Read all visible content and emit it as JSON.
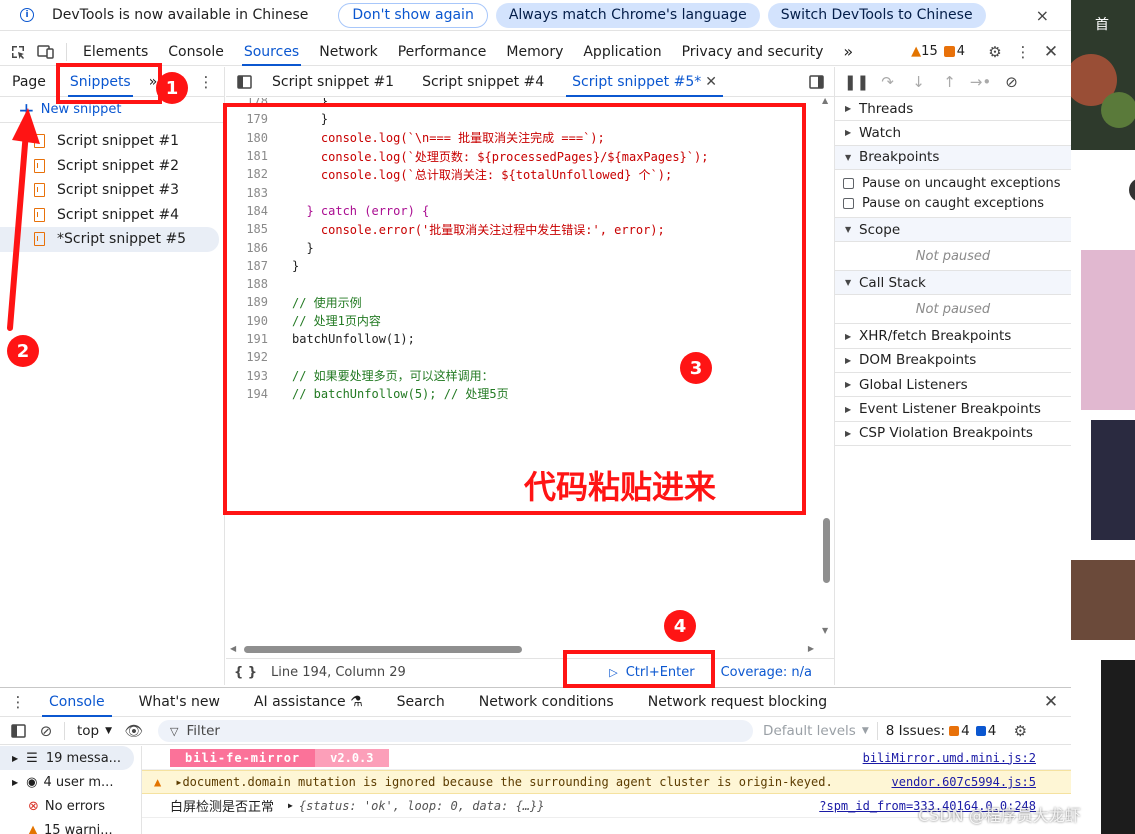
{
  "infobar": {
    "message": "DevTools is now available in Chinese",
    "dont_show": "Don't show again",
    "match_lang": "Always match Chrome's language",
    "switch_lang": "Switch DevTools to Chinese",
    "close": "×"
  },
  "main_tabs": {
    "items": [
      "Elements",
      "Console",
      "Sources",
      "Network",
      "Performance",
      "Memory",
      "Application",
      "Privacy and security"
    ],
    "active": "Sources",
    "more": "»",
    "warnings": "15",
    "errors": "4"
  },
  "navigator": {
    "tabs": [
      "Page",
      "Snippets"
    ],
    "more": "»",
    "new_snippet": "New snippet",
    "snippets": [
      "Script snippet #1",
      "Script snippet #2",
      "Script snippet #3",
      "Script snippet #4",
      "*Script snippet #5"
    ]
  },
  "editor": {
    "tabs": [
      "Script snippet #1",
      "Script snippet #4",
      "Script snippet #5*"
    ],
    "lines": [
      {
        "n": "178",
        "code": "    }"
      },
      {
        "n": "179",
        "code": "    }"
      },
      {
        "n": "180",
        "code": "    console.log(`\\n=== 批量取消关注完成 ===`);"
      },
      {
        "n": "181",
        "code": "    console.log(`处理页数: ${processedPages}/${maxPages}`);"
      },
      {
        "n": "182",
        "code": "    console.log(`总计取消关注: ${totalUnfollowed} 个`);"
      },
      {
        "n": "183",
        "code": ""
      },
      {
        "n": "184",
        "code": "  } catch (error) {"
      },
      {
        "n": "185",
        "code": "    console.error('批量取消关注过程中发生错误:', error);"
      },
      {
        "n": "186",
        "code": "  }"
      },
      {
        "n": "187",
        "code": "}"
      },
      {
        "n": "188",
        "code": ""
      },
      {
        "n": "189",
        "code": "// 使用示例"
      },
      {
        "n": "190",
        "code": "// 处理1页内容"
      },
      {
        "n": "191",
        "code": "batchUnfollow(1);"
      },
      {
        "n": "192",
        "code": ""
      },
      {
        "n": "193",
        "code": "// 如果要处理多页，可以这样调用："
      },
      {
        "n": "194",
        "code": "// batchUnfollow(5); // 处理5页"
      }
    ],
    "status": {
      "position": "Line 194, Column 29",
      "run": "Ctrl+Enter",
      "coverage": "Coverage: n/a"
    }
  },
  "debugger": {
    "threads": "Threads",
    "watch": "Watch",
    "breakpoints": "Breakpoints",
    "pause_uncaught": "Pause on uncaught exceptions",
    "pause_caught": "Pause on caught exceptions",
    "scope": "Scope",
    "not_paused": "Not paused",
    "call_stack": "Call Stack",
    "more_sections": [
      "XHR/fetch Breakpoints",
      "DOM Breakpoints",
      "Global Listeners",
      "Event Listener Breakpoints",
      "CSP Violation Breakpoints"
    ]
  },
  "drawer": {
    "tabs": [
      "Console",
      "What's new",
      "AI assistance ⚗",
      "Search",
      "Network conditions",
      "Network request blocking"
    ],
    "context": "top",
    "filter_placeholder": "Filter",
    "levels": "Default levels",
    "issues_label": "8 Issues:",
    "issues_err": "4",
    "issues_info": "4",
    "side": [
      "19 messa...",
      "4 user m...",
      "No errors",
      "15 warni..."
    ],
    "output": {
      "badge1": "bili-fe-mirror",
      "badge2": "v2.0.3",
      "link1": "biliMirror.umd.mini.js:2",
      "warn": "▸document.domain mutation is ignored because the surrounding agent cluster is origin-keyed.",
      "link2": "vendor.607c5994.js:5",
      "log_label": "白屏检测是否正常",
      "log_obj": "{status: 'ok', loop: 0, data: {…}}",
      "link3": "?spm_id_from=333.40164.0.0:248"
    }
  },
  "annotations": {
    "n1": "1",
    "n2": "2",
    "n3": "3",
    "n4": "4",
    "caption": "代码粘贴进来",
    "watermark": "CSDN @程序员大龙虾",
    "site_tab": "首"
  }
}
